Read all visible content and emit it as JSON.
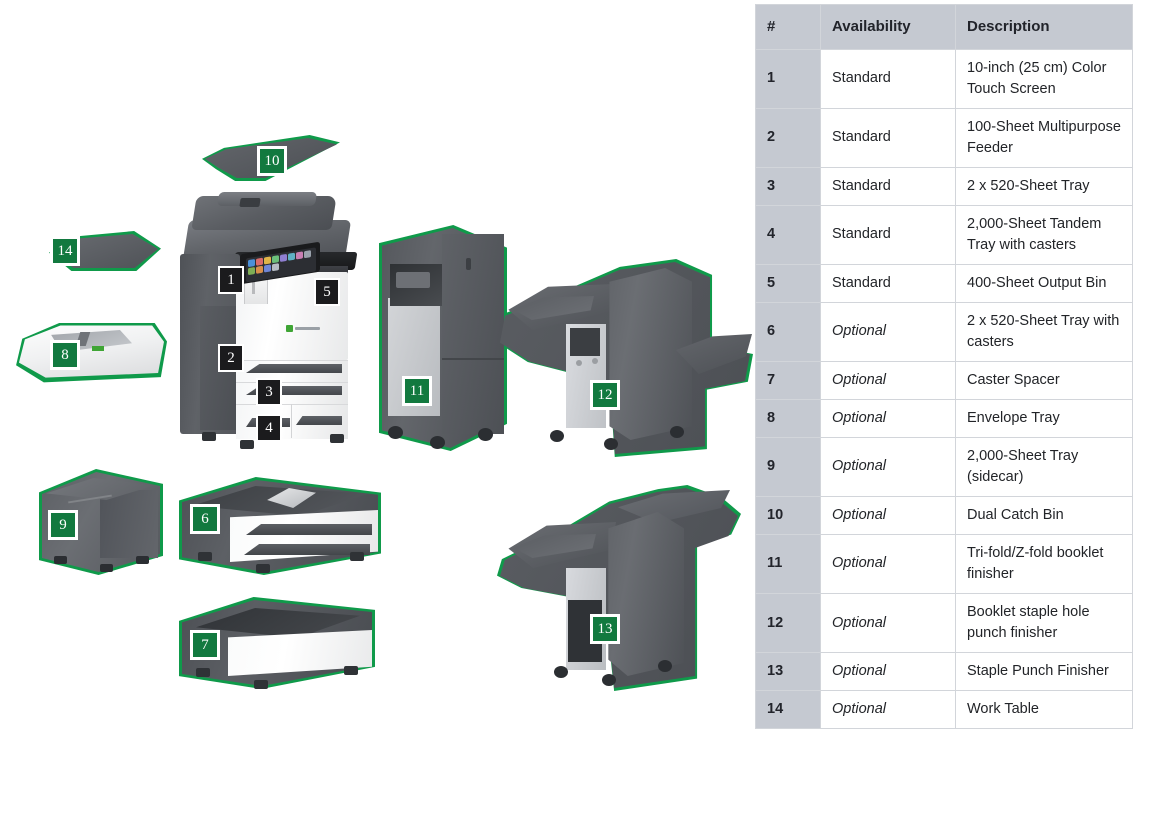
{
  "table": {
    "headers": {
      "number": "#",
      "availability": "Availability",
      "description": "Description"
    },
    "rows": [
      {
        "num": "1",
        "availability": "Standard",
        "description": "10-inch (25 cm) Color Touch Screen"
      },
      {
        "num": "2",
        "availability": "Standard",
        "description": "100-Sheet Multipurpose Feeder"
      },
      {
        "num": "3",
        "availability": "Standard",
        "description": "2 x 520-Sheet Tray"
      },
      {
        "num": "4",
        "availability": "Standard",
        "description": "2,000-Sheet Tandem Tray with casters"
      },
      {
        "num": "5",
        "availability": "Standard",
        "description": "400-Sheet Output Bin"
      },
      {
        "num": "6",
        "availability": "Optional",
        "description": "2 x 520-Sheet Tray with casters"
      },
      {
        "num": "7",
        "availability": "Optional",
        "description": "Caster Spacer"
      },
      {
        "num": "8",
        "availability": "Optional",
        "description": "Envelope Tray"
      },
      {
        "num": "9",
        "availability": "Optional",
        "description": "2,000-Sheet Tray (sidecar)"
      },
      {
        "num": "10",
        "availability": "Optional",
        "description": "Dual Catch Bin"
      },
      {
        "num": "11",
        "availability": "Optional",
        "description": "Tri-fold/Z-fold booklet finisher"
      },
      {
        "num": "12",
        "availability": "Optional",
        "description": "Booklet staple hole punch finisher"
      },
      {
        "num": "13",
        "availability": "Optional",
        "description": "Staple Punch Finisher"
      },
      {
        "num": "14",
        "availability": "Optional",
        "description": "Work Table"
      }
    ]
  },
  "diagram": {
    "callouts": {
      "c1": "1",
      "c2": "2",
      "c3": "3",
      "c4": "4",
      "c5": "5",
      "c6": "6",
      "c7": "7",
      "c8": "8",
      "c9": "9",
      "c10": "10",
      "c11": "11",
      "c12": "12",
      "c13": "13",
      "c14": "14"
    }
  },
  "colors": {
    "header_bg": "#c5c9d1",
    "highlight_green": "#0f9a4a",
    "badge_green": "#12793f",
    "badge_black": "#1b1b1d",
    "brand_green": "#3fa535",
    "border": "#d2d5da",
    "text": "#22242b"
  }
}
